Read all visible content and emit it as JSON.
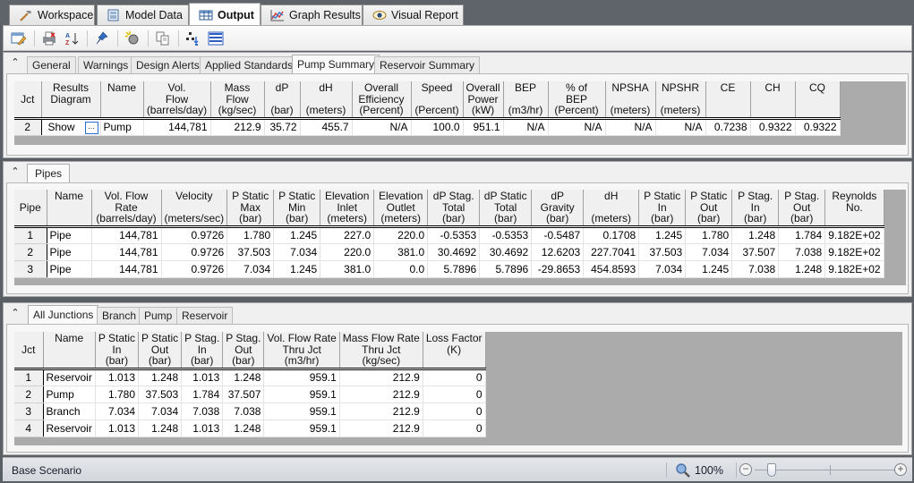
{
  "top_tabs": [
    {
      "label": "Workspace",
      "icon": "hammer-icon",
      "active": false
    },
    {
      "label": "Model Data",
      "icon": "model-data-icon",
      "active": false
    },
    {
      "label": "Output",
      "icon": "table-icon",
      "active": true
    },
    {
      "label": "Graph Results",
      "icon": "graph-icon",
      "active": false
    },
    {
      "label": "Visual Report",
      "icon": "eye-icon",
      "active": false
    }
  ],
  "toolbar": {
    "buttons": [
      "edit-output-icon",
      "print-icon",
      "sort-az-icon",
      "pin-icon",
      "highlight-icon",
      "copy-icon",
      "hierarchy-icon",
      "list-icon"
    ]
  },
  "panel1": {
    "tabs": [
      "General",
      "Warnings",
      "Design Alerts",
      "Applied Standards",
      "Pump Summary",
      "Reservoir Summary"
    ],
    "active_tab": "Pump Summary",
    "headers": [
      [
        "Jct"
      ],
      [
        "Results",
        "Diagram"
      ],
      [
        "Name"
      ],
      [
        "Vol.",
        "Flow",
        "(barrels/day)"
      ],
      [
        "Mass",
        "Flow",
        "(kg/sec)"
      ],
      [
        "dP",
        "",
        "(bar)"
      ],
      [
        "dH",
        "",
        "(meters)"
      ],
      [
        "Overall",
        "Efficiency",
        "(Percent)"
      ],
      [
        "Speed",
        "",
        "(Percent)"
      ],
      [
        "Overall",
        "Power",
        "(kW)"
      ],
      [
        "BEP",
        "",
        "(m3/hr)"
      ],
      [
        "% of",
        "BEP",
        "(Percent)"
      ],
      [
        "NPSHA",
        "",
        "(meters)"
      ],
      [
        "NPSHR",
        "",
        "(meters)"
      ],
      [
        "CE"
      ],
      [
        "CH"
      ],
      [
        "CQ"
      ]
    ],
    "rows": [
      {
        "jct": "2",
        "results_diagram": "Show",
        "button": "...",
        "name": "Pump",
        "vol_flow": "144,781",
        "mass_flow": "212.9",
        "dp": "35.72",
        "dh": "455.7",
        "overall_eff": "N/A",
        "speed": "100.0",
        "power": "951.1",
        "bep": "N/A",
        "pct_bep": "N/A",
        "npsha": "N/A",
        "npshr": "N/A",
        "ce": "0.7238",
        "ch": "0.9322",
        "cq": "0.9322"
      }
    ]
  },
  "panel2": {
    "tabs": [
      "Pipes"
    ],
    "active_tab": "Pipes",
    "headers": [
      [
        "Pipe"
      ],
      [
        "Name"
      ],
      [
        "Vol. Flow",
        "Rate",
        "(barrels/day)"
      ],
      [
        "Velocity",
        "",
        "(meters/sec)"
      ],
      [
        "P Static",
        "Max",
        "(bar)"
      ],
      [
        "P Static",
        "Min",
        "(bar)"
      ],
      [
        "Elevation",
        "Inlet",
        "(meters)"
      ],
      [
        "Elevation",
        "Outlet",
        "(meters)"
      ],
      [
        "dP Stag.",
        "Total",
        "(bar)"
      ],
      [
        "dP Static",
        "Total",
        "(bar)"
      ],
      [
        "dP",
        "Gravity",
        "(bar)"
      ],
      [
        "dH",
        "",
        "(meters)"
      ],
      [
        "P Static",
        "In",
        "(bar)"
      ],
      [
        "P Static",
        "Out",
        "(bar)"
      ],
      [
        "P Stag.",
        "In",
        "(bar)"
      ],
      [
        "P Stag.",
        "Out",
        "(bar)"
      ],
      [
        "Reynolds",
        "No."
      ]
    ],
    "rows": [
      [
        "1",
        "Pipe",
        "144,781",
        "0.9726",
        "1.780",
        "1.245",
        "227.0",
        "220.0",
        "-0.5353",
        "-0.5353",
        "-0.5487",
        "0.1708",
        "1.245",
        "1.780",
        "1.248",
        "1.784",
        "9.182E+02"
      ],
      [
        "2",
        "Pipe",
        "144,781",
        "0.9726",
        "37.503",
        "7.034",
        "220.0",
        "381.0",
        "30.4692",
        "30.4692",
        "12.6203",
        "227.7041",
        "37.503",
        "7.034",
        "37.507",
        "7.038",
        "9.182E+02"
      ],
      [
        "3",
        "Pipe",
        "144,781",
        "0.9726",
        "7.034",
        "1.245",
        "381.0",
        "0.0",
        "5.7896",
        "5.7896",
        "-29.8653",
        "454.8593",
        "7.034",
        "1.245",
        "7.038",
        "1.248",
        "9.182E+02"
      ]
    ]
  },
  "panel3": {
    "tabs": [
      "All Junctions",
      "Branch",
      "Pump",
      "Reservoir"
    ],
    "active_tab": "All Junctions",
    "headers": [
      [
        "Jct"
      ],
      [
        "Name"
      ],
      [
        "P Static",
        "In",
        "(bar)"
      ],
      [
        "P Static",
        "Out",
        "(bar)"
      ],
      [
        "P Stag.",
        "In",
        "(bar)"
      ],
      [
        "P Stag.",
        "Out",
        "(bar)"
      ],
      [
        "Vol. Flow Rate",
        "Thru Jct",
        "(m3/hr)"
      ],
      [
        "Mass Flow Rate",
        "Thru Jct",
        "(kg/sec)"
      ],
      [
        "Loss Factor",
        "(K)"
      ]
    ],
    "rows": [
      [
        "1",
        "Reservoir",
        "1.013",
        "1.248",
        "1.013",
        "1.248",
        "959.1",
        "212.9",
        "0"
      ],
      [
        "2",
        "Pump",
        "1.780",
        "37.503",
        "1.784",
        "37.507",
        "959.1",
        "212.9",
        "0"
      ],
      [
        "3",
        "Branch",
        "7.034",
        "7.034",
        "7.038",
        "7.038",
        "959.1",
        "212.9",
        "0"
      ],
      [
        "4",
        "Reservoir",
        "1.013",
        "1.248",
        "1.013",
        "1.248",
        "959.1",
        "212.9",
        "0"
      ]
    ]
  },
  "statusbar": {
    "scenario": "Base Scenario",
    "zoom_label": "100%",
    "zoom_minus": "−",
    "zoom_plus": "+"
  },
  "colors": {
    "grid_bg": "#ababab",
    "header_bg": "#f0f0f0",
    "window_bg": "#5a5f66"
  }
}
